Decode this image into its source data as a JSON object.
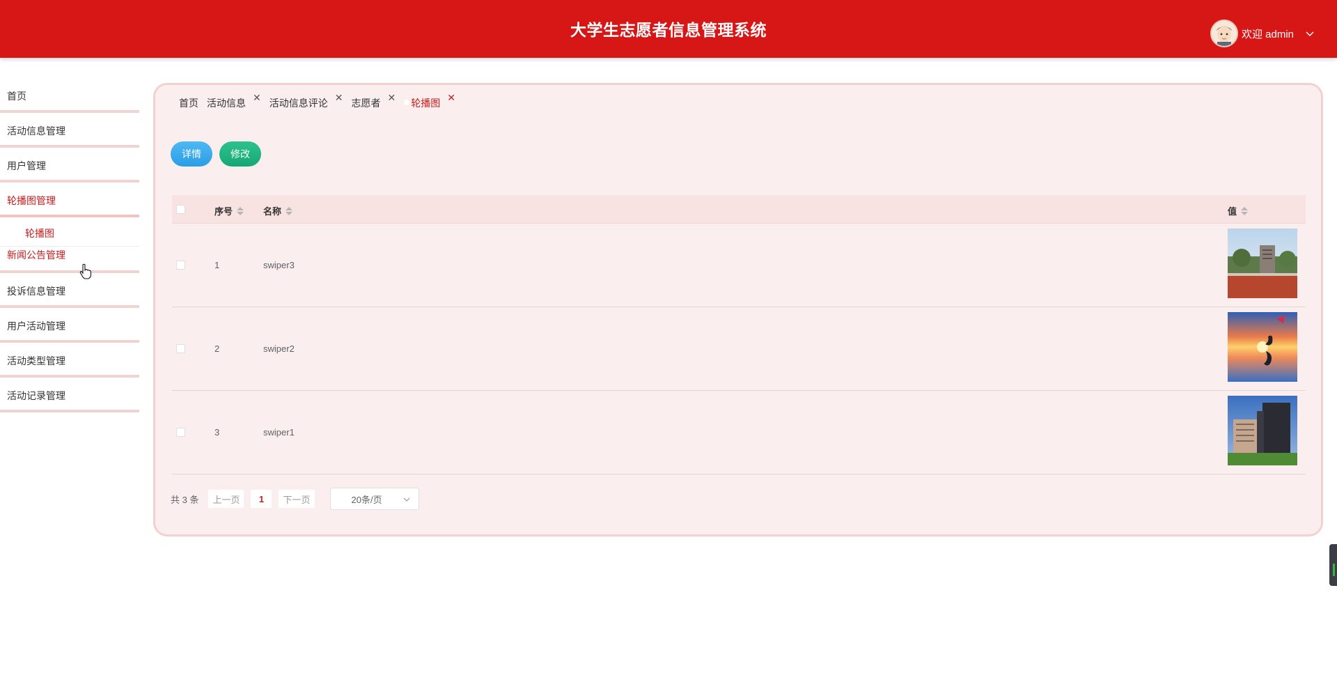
{
  "header": {
    "title": "大学生志愿者信息管理系统",
    "welcome": "欢迎 admin"
  },
  "sidebar": {
    "items": [
      {
        "label": "首页"
      },
      {
        "label": "活动信息管理"
      },
      {
        "label": "用户管理"
      },
      {
        "label": "轮播图管理"
      },
      {
        "label": "新闻公告管理"
      },
      {
        "label": "投诉信息管理"
      },
      {
        "label": "用户活动管理"
      },
      {
        "label": "活动类型管理"
      },
      {
        "label": "活动记录管理"
      }
    ],
    "submenu": {
      "label": "轮播图"
    }
  },
  "tabs": [
    {
      "label": "首页"
    },
    {
      "label": "活动信息"
    },
    {
      "label": "活动信息评论"
    },
    {
      "label": "志愿者"
    },
    {
      "label": "轮播图"
    }
  ],
  "toolbar": {
    "detail_label": "详情",
    "edit_label": "修改"
  },
  "table": {
    "columns": {
      "index": "序号",
      "name": "名称",
      "value": "值"
    },
    "rows": [
      {
        "index": "1",
        "name": "swiper3"
      },
      {
        "index": "2",
        "name": "swiper2"
      },
      {
        "index": "3",
        "name": "swiper1"
      }
    ]
  },
  "pagination": {
    "total": "共 3 条",
    "prev": "上一页",
    "current": "1",
    "next": "下一页",
    "page_size": "20条/页"
  },
  "colors": {
    "header": "#d71616",
    "accent": "#c81b1b",
    "panel": "#faeeee"
  }
}
